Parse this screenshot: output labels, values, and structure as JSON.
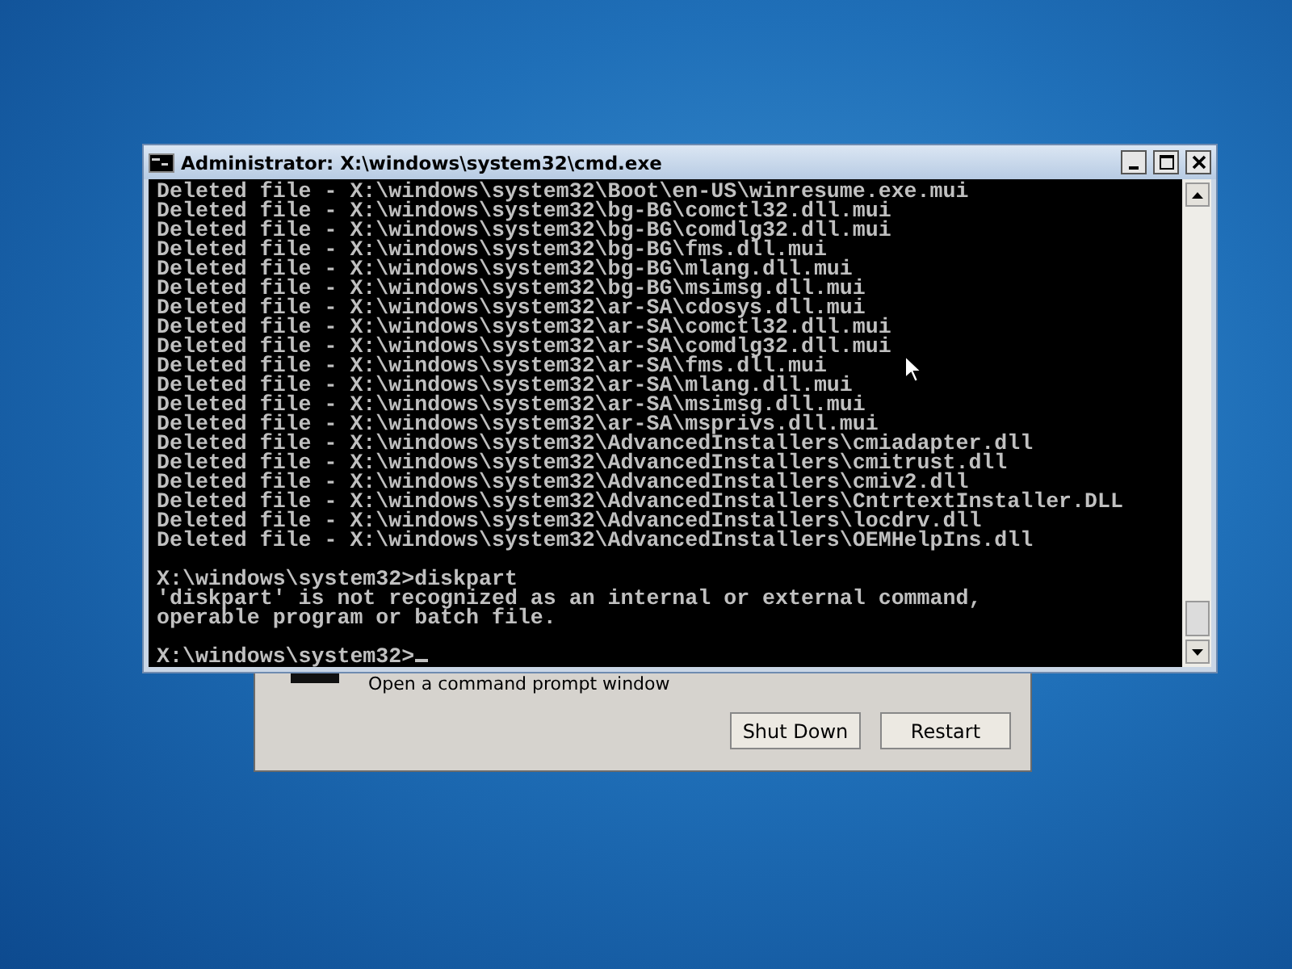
{
  "window": {
    "title": "Administrator: X:\\windows\\system32\\cmd.exe"
  },
  "console": {
    "lines": [
      "Deleted file - X:\\windows\\system32\\Boot\\en-US\\winresume.exe.mui",
      "Deleted file - X:\\windows\\system32\\bg-BG\\comctl32.dll.mui",
      "Deleted file - X:\\windows\\system32\\bg-BG\\comdlg32.dll.mui",
      "Deleted file - X:\\windows\\system32\\bg-BG\\fms.dll.mui",
      "Deleted file - X:\\windows\\system32\\bg-BG\\mlang.dll.mui",
      "Deleted file - X:\\windows\\system32\\bg-BG\\msimsg.dll.mui",
      "Deleted file - X:\\windows\\system32\\ar-SA\\cdosys.dll.mui",
      "Deleted file - X:\\windows\\system32\\ar-SA\\comctl32.dll.mui",
      "Deleted file - X:\\windows\\system32\\ar-SA\\comdlg32.dll.mui",
      "Deleted file - X:\\windows\\system32\\ar-SA\\fms.dll.mui",
      "Deleted file - X:\\windows\\system32\\ar-SA\\mlang.dll.mui",
      "Deleted file - X:\\windows\\system32\\ar-SA\\msimsg.dll.mui",
      "Deleted file - X:\\windows\\system32\\ar-SA\\msprivs.dll.mui",
      "Deleted file - X:\\windows\\system32\\AdvancedInstallers\\cmiadapter.dll",
      "Deleted file - X:\\windows\\system32\\AdvancedInstallers\\cmitrust.dll",
      "Deleted file - X:\\windows\\system32\\AdvancedInstallers\\cmiv2.dll",
      "Deleted file - X:\\windows\\system32\\AdvancedInstallers\\CntrtextInstaller.DLL",
      "Deleted file - X:\\windows\\system32\\AdvancedInstallers\\locdrv.dll",
      "Deleted file - X:\\windows\\system32\\AdvancedInstallers\\OEMHelpIns.dll",
      {
        "kind": "blank"
      },
      "X:\\windows\\system32>diskpart",
      "'diskpart' is not recognized as an internal or external command,",
      "operable program or batch file.",
      {
        "kind": "blank"
      },
      "X:\\windows\\system32>"
    ]
  },
  "dialog": {
    "option": "Open a command prompt window",
    "buttons": [
      "Shut Down",
      "Restart"
    ]
  }
}
